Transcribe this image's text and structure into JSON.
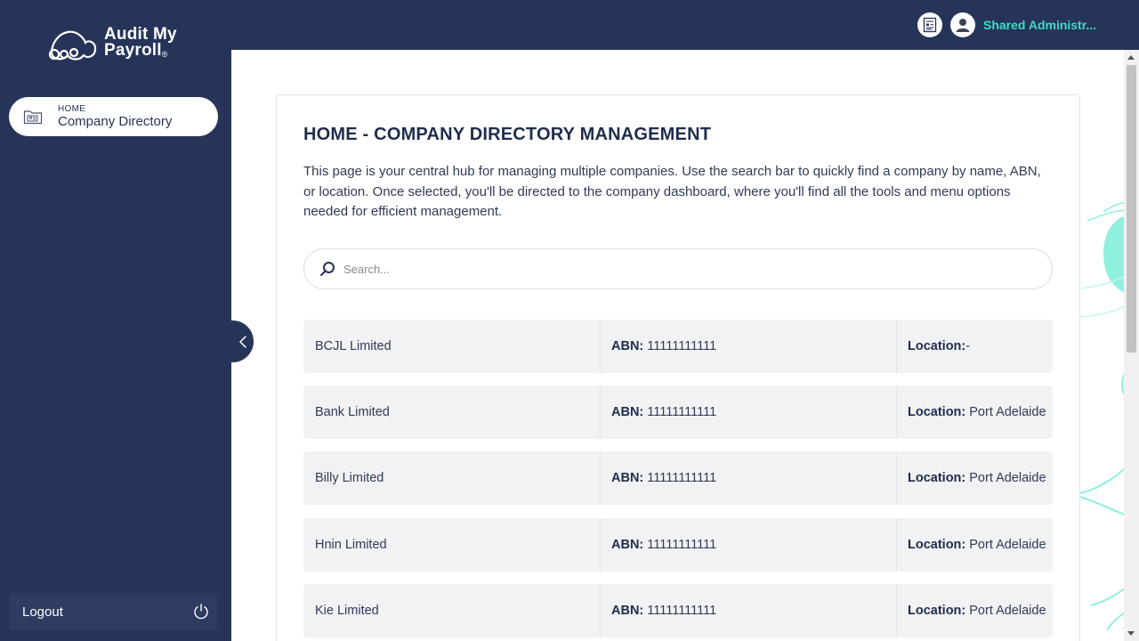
{
  "brand": {
    "line1": "Audit My",
    "line2": "Payroll",
    "mark": "®"
  },
  "sidebar": {
    "nav": [
      {
        "kicker": "HOME",
        "label": "Company Directory",
        "icon": "folder-user-icon"
      }
    ],
    "logout_label": "Logout"
  },
  "topbar": {
    "user_name": "Shared Administr..."
  },
  "page": {
    "title": "HOME - COMPANY DIRECTORY MANAGEMENT",
    "intro": "This page is your central hub for managing multiple companies. Use the search bar to quickly find a company by name, ABN, or location. Once selected, you'll be directed to the company dashboard, where you'll find all the tools and menu options needed for efficient management."
  },
  "search": {
    "placeholder": "Search..."
  },
  "labels": {
    "abn": "ABN:",
    "location": "Location:"
  },
  "companies": [
    {
      "name": "BCJL Limited",
      "abn": "11111111111",
      "location": "-"
    },
    {
      "name": "Bank Limited",
      "abn": "11111111111",
      "location": "Port Adelaide"
    },
    {
      "name": "Billy Limited",
      "abn": "11111111111",
      "location": "Port Adelaide"
    },
    {
      "name": "Hnin Limited",
      "abn": "11111111111",
      "location": "Port Adelaide"
    },
    {
      "name": "Kie Limited",
      "abn": "11111111111",
      "location": "Port Adelaide"
    }
  ],
  "colors": {
    "navy": "#253458",
    "accent": "#3fdcc3",
    "row_bg": "#f1f2f4"
  }
}
